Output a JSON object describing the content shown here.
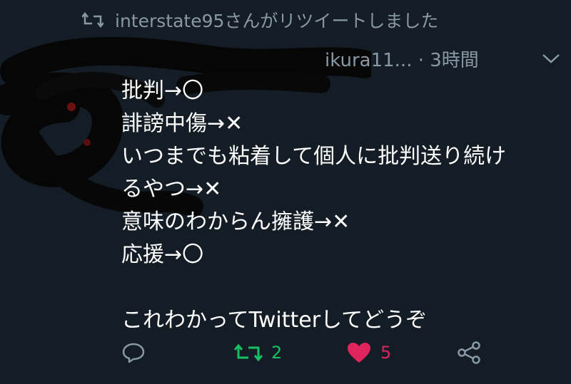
{
  "retweet_notice": {
    "icon": "retweet-icon",
    "text": "interstate95さんがリツイートしました"
  },
  "tweet": {
    "handle_time": "ikura11... · 3時間",
    "lines": [
      "批判→〇",
      "誹謗中傷→✕",
      "いつまでも粘着して個人に批判送り続け",
      "るやつ→✕",
      "意味のわからん擁護→✕",
      "応援→〇",
      "",
      "これわかってTwitterしてどうぞ"
    ]
  },
  "actions": {
    "reply_icon": "reply-icon",
    "retweet_icon": "retweet-icon",
    "retweet_count": "2",
    "like_icon": "heart-icon",
    "like_count": "5",
    "share_icon": "share-icon"
  },
  "colors": {
    "background": "#141d26",
    "secondary_text": "#8899a6",
    "retweet_green": "#17bf63",
    "like_red": "#e0245e"
  }
}
